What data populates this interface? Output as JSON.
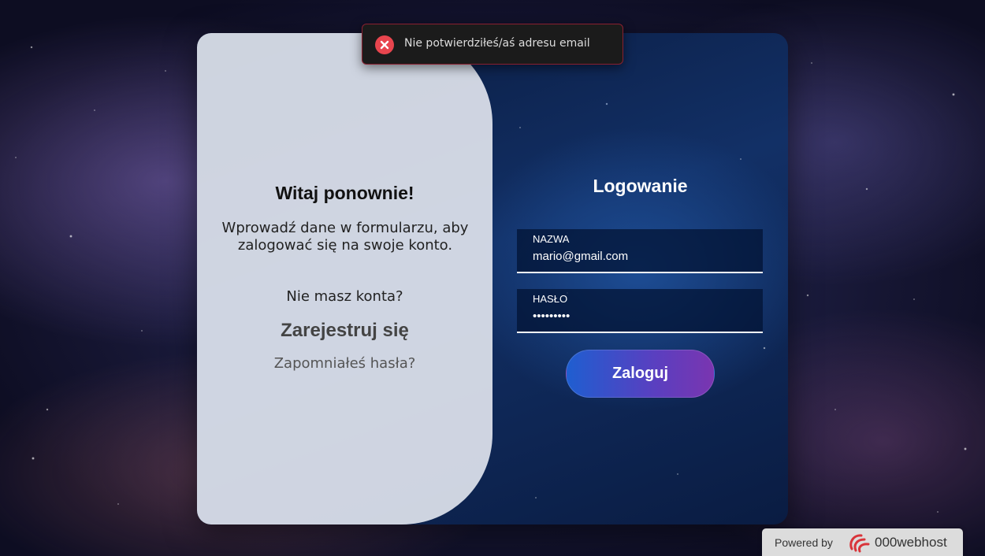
{
  "toast": {
    "message": "Nie potwierdziłeś/aś adresu email",
    "icon": "error-icon",
    "color": "#e8454e"
  },
  "left_panel": {
    "welcome_title": "Witaj ponownie!",
    "description": "Wprowadź dane w formularzu, aby zalogować się na swoje konto.",
    "no_account": "Nie masz konta?",
    "register_link": "Zarejestruj się",
    "forgot_password_link": "Zapomniałeś hasła?"
  },
  "login_form": {
    "title": "Logowanie",
    "username": {
      "label": "NAZWA",
      "value": "mario@gmail.com"
    },
    "password": {
      "label": "HASŁO",
      "value": "mariopass"
    },
    "submit_label": "Zaloguj"
  },
  "footer_badge": {
    "powered_by": "Powered by",
    "brand": "000webhost",
    "logo_icon": "000webhost-logo-icon"
  },
  "colors": {
    "button_gradient_start": "#1f5ed0",
    "button_gradient_end": "#7a35b0",
    "toast_border": "#8a2030"
  }
}
